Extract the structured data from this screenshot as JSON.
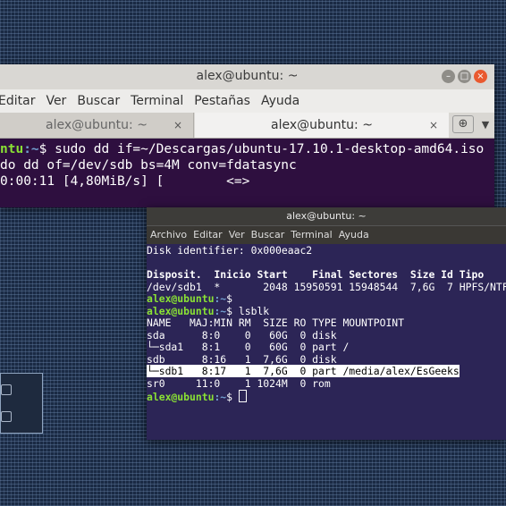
{
  "colors": {
    "prompt_user": "#8ae234",
    "prompt_path": "#729fcf",
    "term1_bg": "#2e0f3f",
    "term2_bg": "#2c2556"
  },
  "window1": {
    "title": "alex@ubuntu: ~",
    "controls": [
      "minimize-icon",
      "maximize-icon",
      "close-icon"
    ],
    "menu": [
      "Editar",
      "Ver",
      "Buscar",
      "Terminal",
      "Pestañas",
      "Ayuda"
    ],
    "tabs": [
      {
        "label": "alex@ubuntu: ~",
        "close": "×"
      },
      {
        "label": "alex@ubuntu: ~",
        "close": "×"
      }
    ],
    "tab_actions": [
      "new-tab-icon",
      "chevron-down-icon"
    ],
    "prompt_user": "ntu",
    "prompt_path": ":~",
    "command_line1": "$ sudo dd if=~/Descargas/ubuntu-17.10.1-desktop-amd64.iso |",
    "command_line2": "do dd of=/dev/sdb bs=4M conv=fdatasync",
    "progress_left": "0:00:11 [4,80MiB/s] [",
    "progress_mid": "<=>",
    "progress_right": "]"
  },
  "window2": {
    "title": "alex@ubuntu: ~",
    "menu": [
      "Archivo",
      "Editar",
      "Ver",
      "Buscar",
      "Terminal",
      "Ayuda"
    ],
    "lines": [
      "Disk identifier: 0x000eaac2",
      "",
      "Disposit.  Inicio Start    Final Sectores  Size Id Tipo",
      "/dev/sdb1  *       2048 15950591 15948544  7,6G  7 HPFS/NTFS",
      "",
      "",
      "NAME   MAJ:MIN RM  SIZE RO TYPE MOUNTPOINT",
      "sda      8:0    0   60G  0 disk",
      "└─sda1   8:1    0   60G  0 part /",
      "sdb      8:16   1  7,6G  0 disk",
      "",
      "sr0     11:0    1 1024M  0 rom"
    ],
    "prompt_user": "alex@ubuntu",
    "prompt_path": ":~",
    "cmd_empty": "$",
    "cmd_lsblk": "$ lsblk",
    "cmd_last": "$ ",
    "highlight_line": "└─sdb1   8:17   1  7,6G  0 part /media/alex/EsGeeks"
  }
}
